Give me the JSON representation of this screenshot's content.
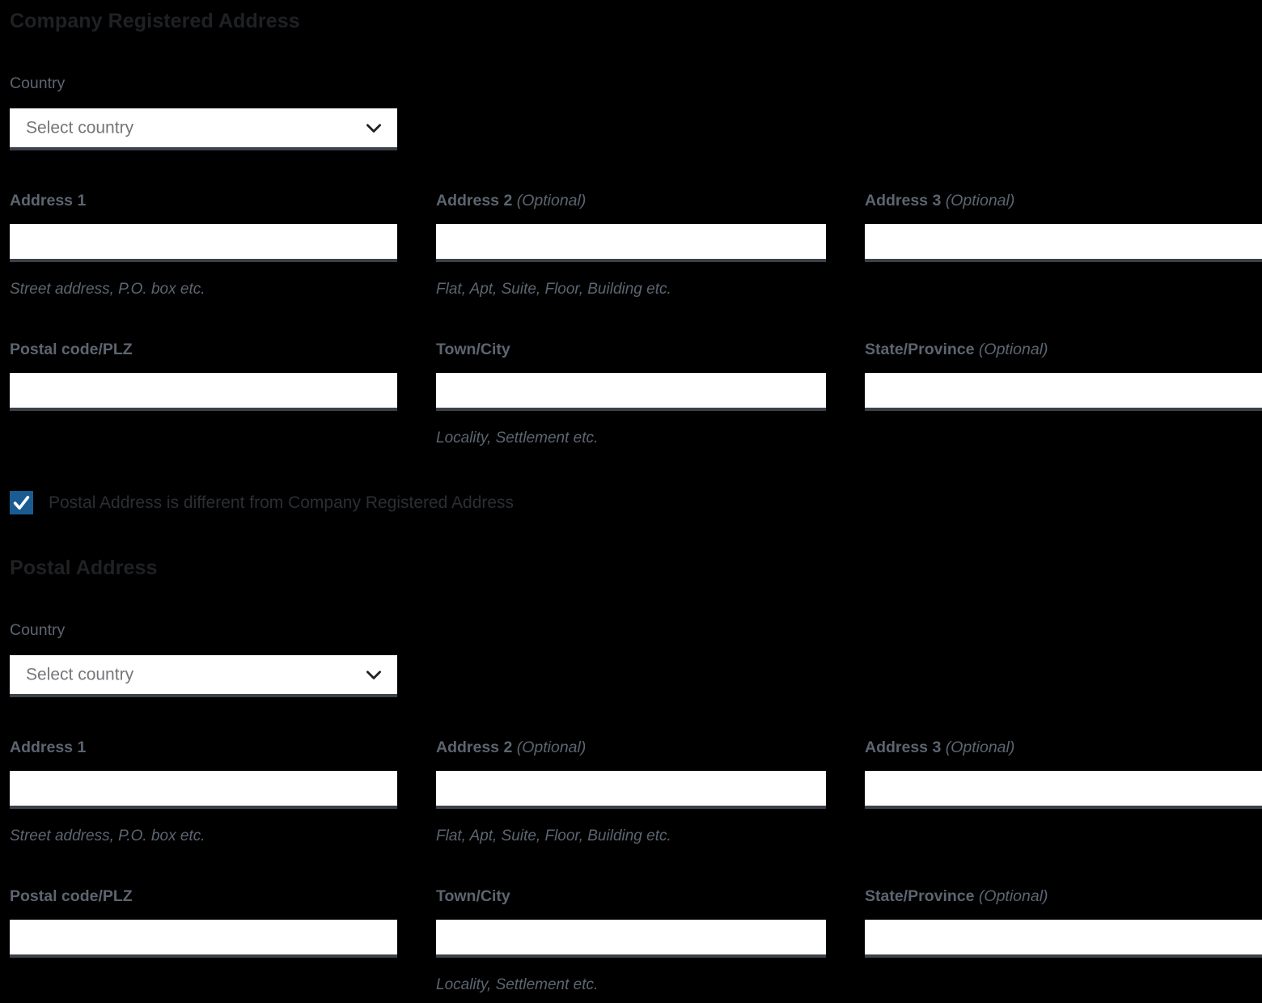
{
  "theme": {
    "page_background": "#000000",
    "input_background": "#ffffff",
    "input_underline": "#3d414a",
    "label_color": "#5c6570",
    "heading_color": "#1f2124",
    "checkbox_accent": "#1a5c92",
    "placeholder_color": "#74767a"
  },
  "sections": [
    {
      "heading": "Company Registered Address",
      "country": {
        "label": "Country",
        "placeholder": "Select country",
        "value": "Select country",
        "chevron_icon": "chevron-down-icon"
      },
      "address_row": [
        {
          "label": "Address 1",
          "optional": "",
          "value": "",
          "helper": "Street address, P.O. box etc."
        },
        {
          "label": "Address 2",
          "optional": "(Optional)",
          "value": "",
          "helper": "Flat, Apt, Suite, Floor, Building etc."
        },
        {
          "label": "Address 3",
          "optional": "(Optional)",
          "value": "",
          "helper": ""
        }
      ],
      "locality_row": [
        {
          "label": "Postal code/PLZ",
          "optional": "",
          "value": "",
          "helper": ""
        },
        {
          "label": "Town/City",
          "optional": "",
          "value": "",
          "helper": "Locality, Settlement etc."
        },
        {
          "label": "State/Province",
          "optional": "(Optional)",
          "value": "",
          "helper": ""
        }
      ]
    },
    {
      "heading": "Postal Address",
      "country": {
        "label": "Country",
        "placeholder": "Select country",
        "value": "Select country",
        "chevron_icon": "chevron-down-icon"
      },
      "address_row": [
        {
          "label": "Address 1",
          "optional": "",
          "value": "",
          "helper": "Street address, P.O. box etc."
        },
        {
          "label": "Address 2",
          "optional": "(Optional)",
          "value": "",
          "helper": "Flat, Apt, Suite, Floor, Building etc."
        },
        {
          "label": "Address 3",
          "optional": "(Optional)",
          "value": "",
          "helper": ""
        }
      ],
      "locality_row": [
        {
          "label": "Postal code/PLZ",
          "optional": "",
          "value": "",
          "helper": ""
        },
        {
          "label": "Town/City",
          "optional": "",
          "value": "",
          "helper": "Locality, Settlement etc."
        },
        {
          "label": "State/Province",
          "optional": "(Optional)",
          "value": "",
          "helper": ""
        }
      ]
    }
  ],
  "postal_toggle": {
    "label": "Postal Address is different from Company Registered Address",
    "checked": true,
    "check_icon": "check-icon"
  }
}
